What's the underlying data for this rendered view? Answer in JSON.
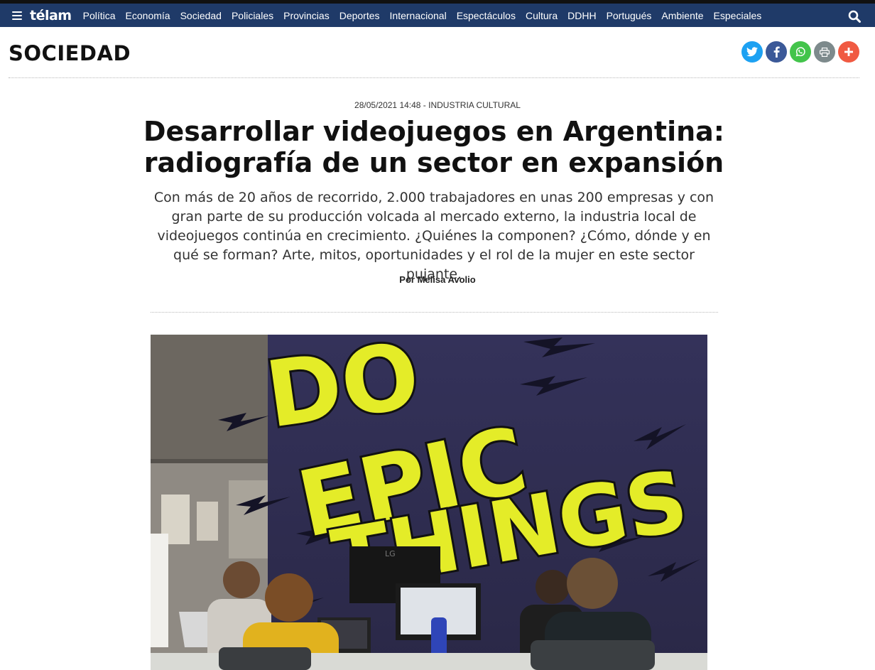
{
  "nav": {
    "logo": "télam",
    "items": [
      "Política",
      "Economía",
      "Sociedad",
      "Policiales",
      "Provincias",
      "Deportes",
      "Internacional",
      "Espectáculos",
      "Cultura",
      "DDHH",
      "Portugués",
      "Ambiente",
      "Especiales"
    ]
  },
  "section": {
    "title": "SOCIEDAD"
  },
  "share": {
    "buttons": [
      {
        "icon": "twitter-icon",
        "color": "#1da1f2"
      },
      {
        "icon": "facebook-icon",
        "color": "#3b5998"
      },
      {
        "icon": "whatsapp-icon",
        "color": "#43c44b"
      },
      {
        "icon": "print-icon",
        "color": "#7d8a8c"
      },
      {
        "icon": "plus-icon",
        "color": "#f05a42"
      }
    ]
  },
  "article": {
    "meta": "28/05/2021 14:48 - INDUSTRIA CULTURAL",
    "headline_line1": "Desarrollar videojuegos en Argentina:",
    "headline_line2": "radiografía de un sector en expansión",
    "lead": "Con más de 20 años de recorrido, 2.000 trabajadores en unas 200 empresas y con gran parte de su producción volcada al mercado externo, la industria local de videojuegos continúa en crecimiento. ¿Quiénes la componen? ¿Cómo, dónde y en qué se forman? Arte, mitos, oportunidades y el rol de la mujer en este sector pujante.",
    "byline": "Por Melisa Avolio"
  },
  "photo": {
    "wall_text": [
      "DO",
      "EPIC",
      "THINGS"
    ],
    "monitor_brand": "LG"
  }
}
